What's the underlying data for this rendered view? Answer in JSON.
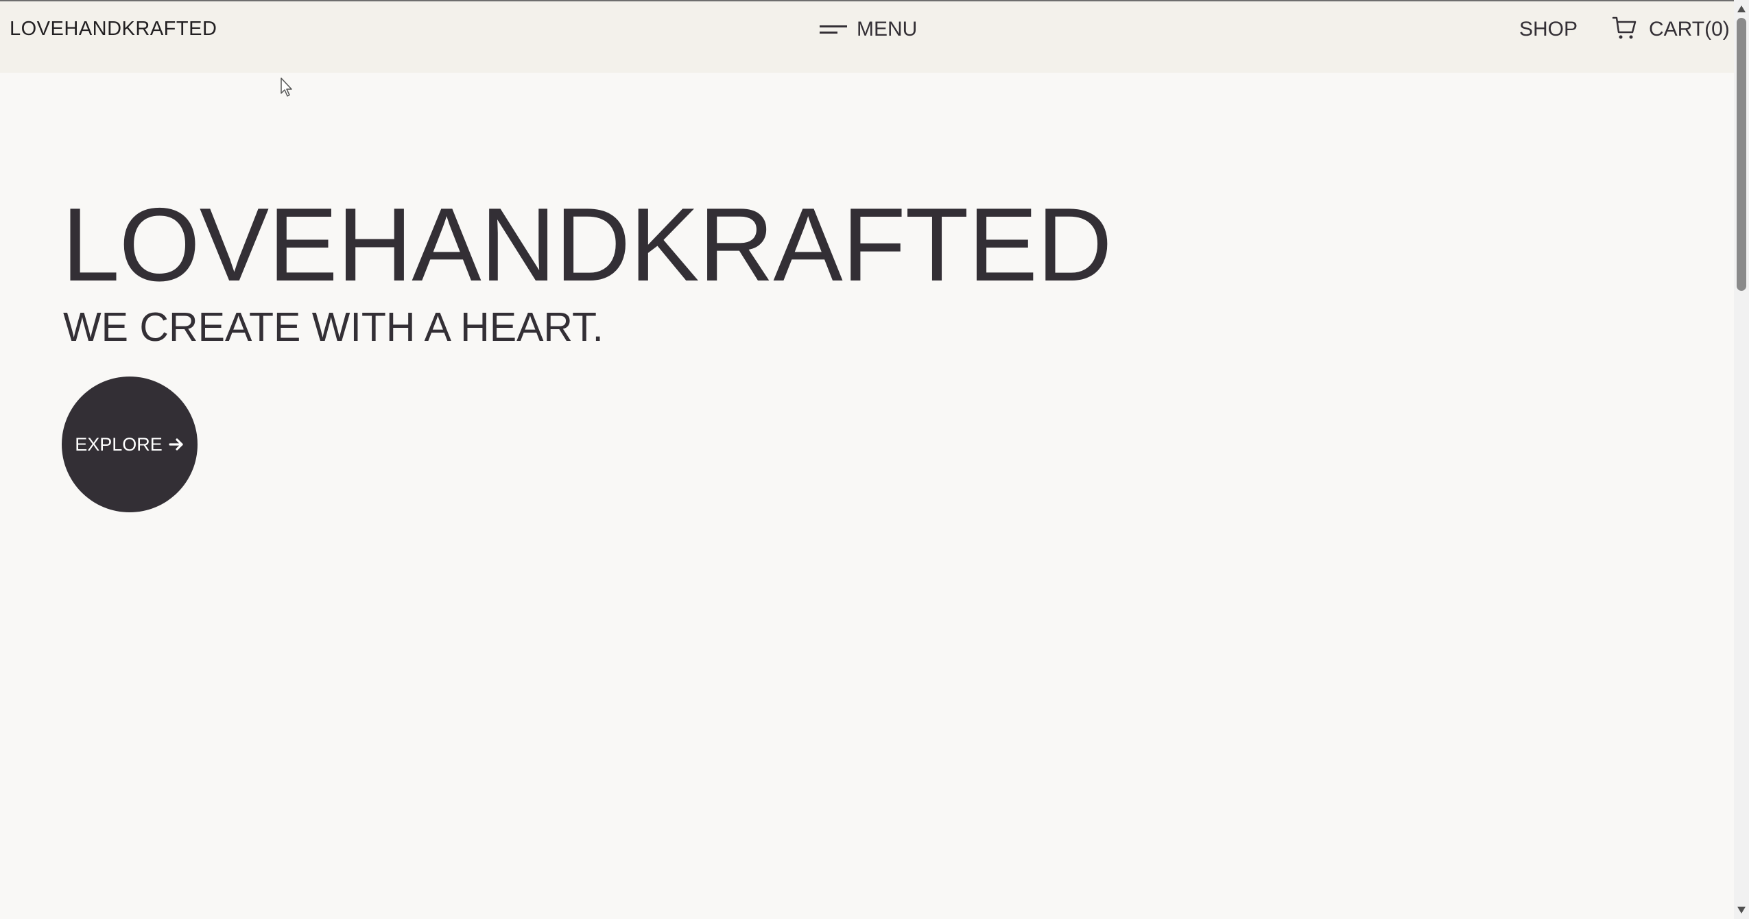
{
  "header": {
    "logo": "LOVEHANDKRAFTED",
    "menu_label": "MENU",
    "shop_label": "SHOP",
    "cart_label": "CART(0)"
  },
  "hero": {
    "title": "LOVEHANDKRAFTED",
    "subtitle": "WE CREATE WITH A HEART.",
    "button_label": "EXPLORE"
  },
  "icons": {
    "menu": "hamburger-menu-icon",
    "cart": "shopping-cart-icon",
    "explore": "arrow-right-icon",
    "cursor": "mouse-pointer-icon"
  },
  "colors": {
    "header_background": "#f3f1eb",
    "page_background": "#f9f8f6",
    "text": "#332f35",
    "button_background": "#332f35",
    "button_text": "#ffffff"
  }
}
